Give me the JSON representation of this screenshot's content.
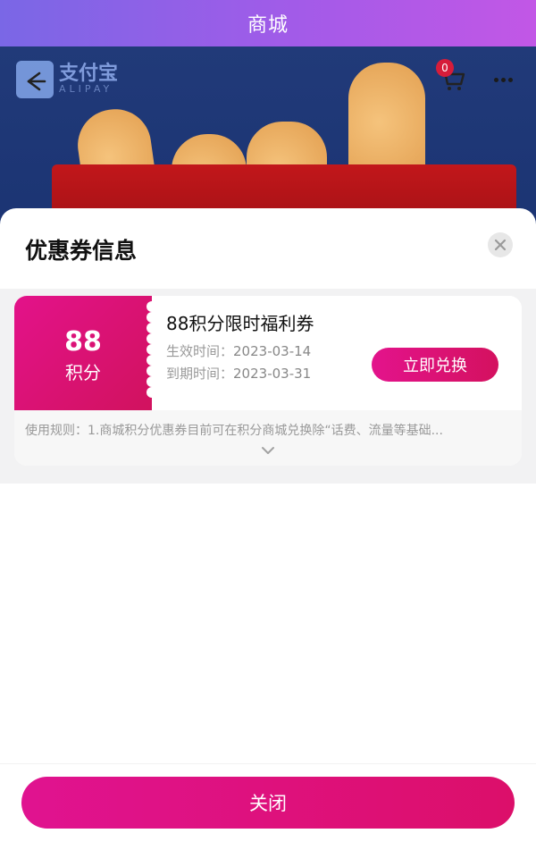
{
  "header": {
    "title": "商城"
  },
  "banner": {
    "brand_name": "支付宝",
    "brand_sub": "ALIPAY",
    "cart_count": "0",
    "icons": [
      "back-arrow-icon",
      "cart-icon",
      "more-icon"
    ]
  },
  "sheet": {
    "title": "优惠券信息",
    "coupon": {
      "points_value": "88",
      "points_unit": "积分",
      "name": "88积分限时福利券",
      "start_label": "生效时间：",
      "start_date": "2023-03-14",
      "end_label": "到期时间：",
      "end_date": "2023-03-31",
      "redeem_label": "立即兑换",
      "rules": "使用规则：1.商城积分优惠券目前可在积分商城兑换除“话费、流量等基础..."
    }
  },
  "footer": {
    "close_label": "关闭"
  },
  "colors": {
    "accent": "#e01390",
    "header_gradient_start": "#7a67e6",
    "header_gradient_end": "#c257e6"
  }
}
